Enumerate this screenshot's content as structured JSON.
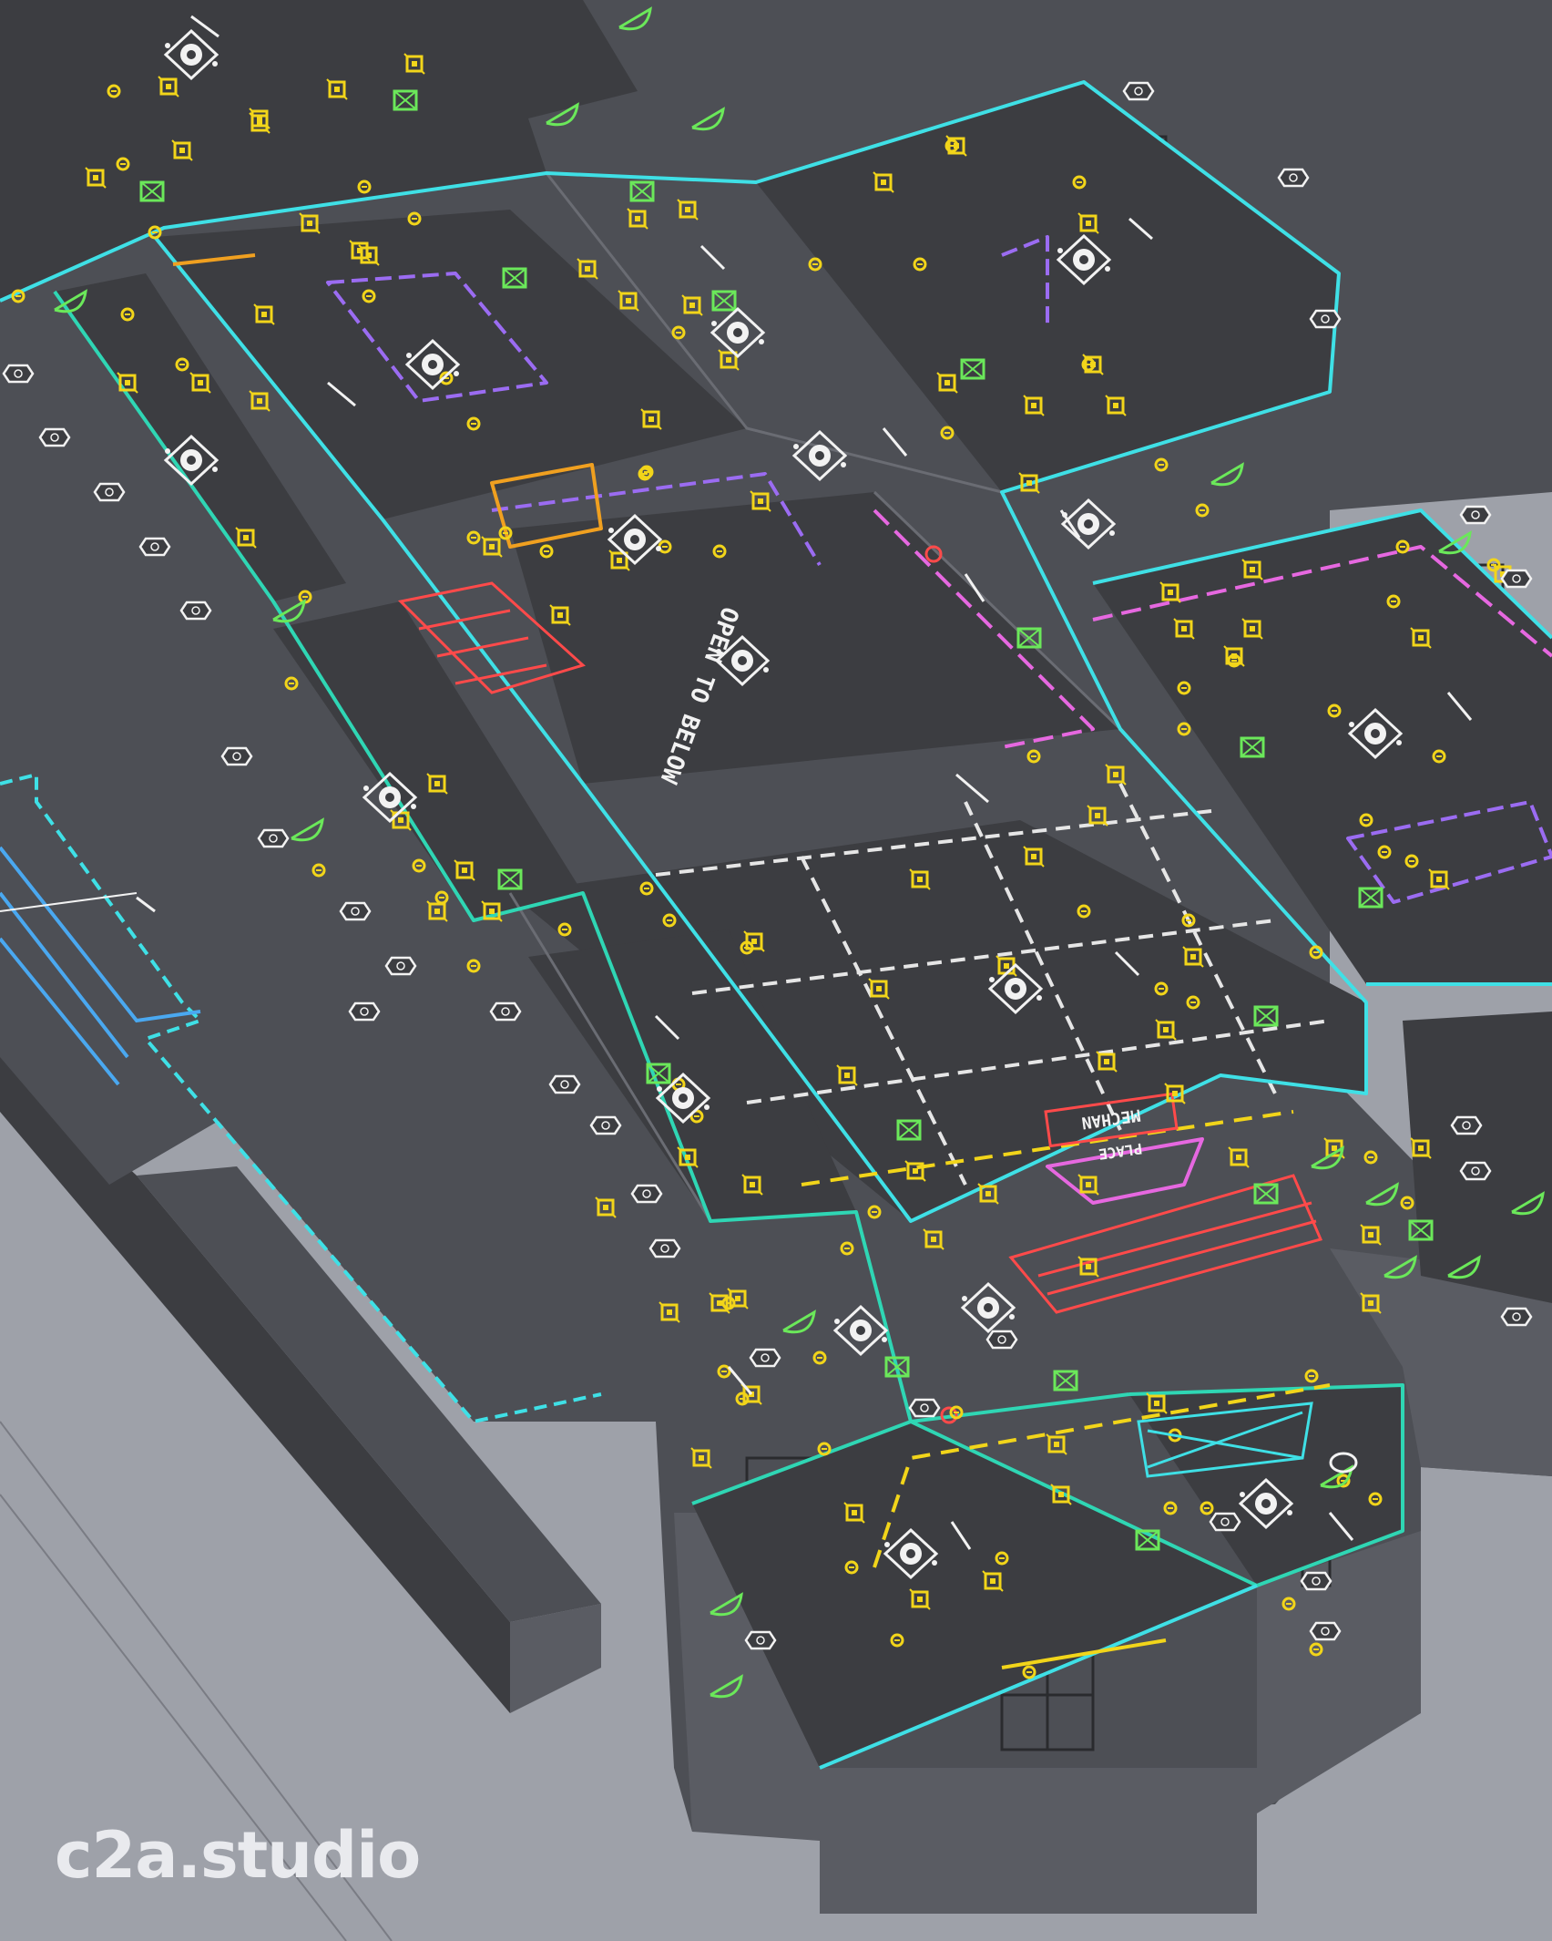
{
  "watermark": "c2a.studio",
  "labels": {
    "open_to_below": "OPEN TO BELOW",
    "mechanical": "MECHAN",
    "place": "PLACE"
  },
  "colors": {
    "ground": "#9ea1a9",
    "floor": "#3c3d41",
    "wall": "#4d4f55",
    "cyan": "#3fe0e6",
    "teal": "#2fd6b4",
    "blue": "#4aa8f0",
    "purple": "#9b6cf2",
    "magenta": "#e668e0",
    "yellow": "#f2d51a",
    "green": "#6be85a",
    "red": "#ff4a4a",
    "orange": "#f0a020",
    "white": "#f2f2f2"
  },
  "icons": {
    "light_fixture": "yellow-square-fixture-icon",
    "receptacle": "yellow-circle-receptacle-icon",
    "exhaust_fan": "green-boxed-x-icon",
    "door_swing": "green-door-swing-icon",
    "ceiling_fan": "white-diamond-fan-icon",
    "hex_tag": "white-hexagon-tag-icon"
  }
}
